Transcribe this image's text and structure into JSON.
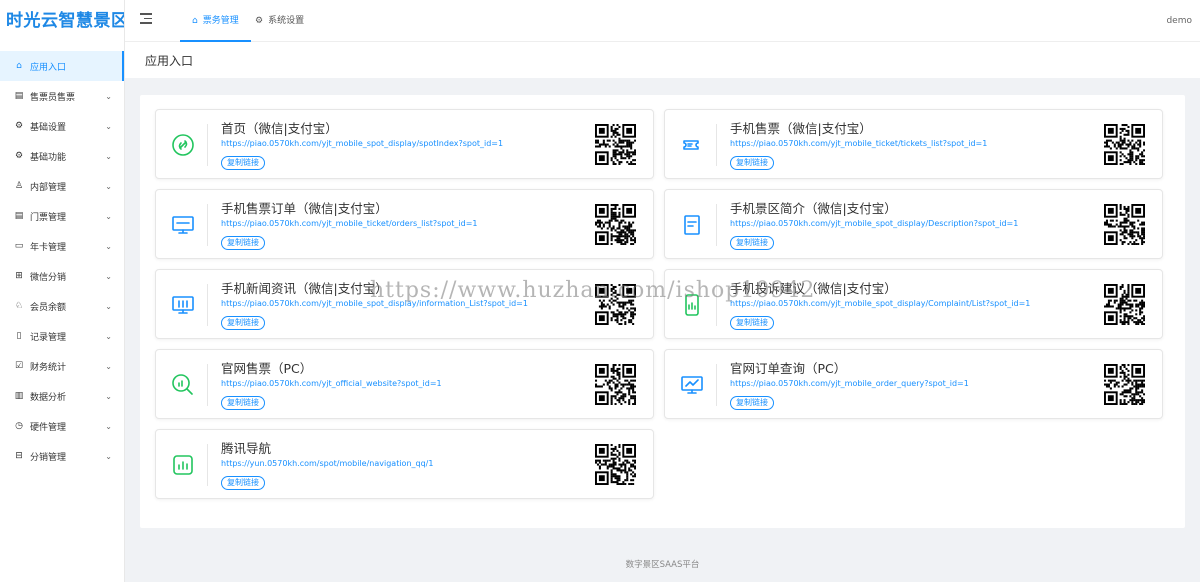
{
  "app": {
    "logo": "时光云智慧景区",
    "user": "demo"
  },
  "header": {
    "tabs": [
      {
        "label": "票务管理",
        "icon": "home-icon"
      },
      {
        "label": "系统设置",
        "icon": "gear-icon"
      }
    ]
  },
  "sidebar": {
    "items": [
      {
        "label": "应用入口",
        "icon": "home-icon",
        "active": true
      },
      {
        "label": "售票员售票",
        "icon": "ticket-icon"
      },
      {
        "label": "基础设置",
        "icon": "gear-icon"
      },
      {
        "label": "基础功能",
        "icon": "gear-icon"
      },
      {
        "label": "内部管理",
        "icon": "user-icon"
      },
      {
        "label": "门票管理",
        "icon": "ticket-icon"
      },
      {
        "label": "年卡管理",
        "icon": "card-icon"
      },
      {
        "label": "微信分销",
        "icon": "network-icon"
      },
      {
        "label": "会员余额",
        "icon": "users-icon"
      },
      {
        "label": "记录管理",
        "icon": "document-icon"
      },
      {
        "label": "财务统计",
        "icon": "check-square-icon"
      },
      {
        "label": "数据分析",
        "icon": "bar-chart-icon"
      },
      {
        "label": "硬件管理",
        "icon": "clock-icon"
      },
      {
        "label": "分销管理",
        "icon": "sitemap-icon"
      }
    ]
  },
  "page": {
    "title": "应用入口"
  },
  "cards": [
    {
      "title": "首页（微信|支付宝）",
      "url": "https://piao.0570kh.com/yjt_mobile_spot_display/spotIndex?spot_id=1",
      "icon": "link-icon",
      "color": "#22c55e"
    },
    {
      "title": "手机售票（微信|支付宝）",
      "url": "https://piao.0570kh.com/yjt_mobile_ticket/tickets_list?spot_id=1",
      "icon": "ticket-icon",
      "color": "#1890ff"
    },
    {
      "title": "手机售票订单（微信|支付宝）",
      "url": "https://piao.0570kh.com/yjt_mobile_ticket/orders_list?spot_id=1",
      "icon": "monitor-icon",
      "color": "#1890ff"
    },
    {
      "title": "手机景区简介（微信|支付宝）",
      "url": "https://piao.0570kh.com/yjt_mobile_spot_display/Description?spot_id=1",
      "icon": "document-icon",
      "color": "#1890ff"
    },
    {
      "title": "手机新闻资讯（微信|支付宝）",
      "url": "https://piao.0570kh.com/yjt_mobile_spot_display/information_List?spot_id=1",
      "icon": "monitor-chart-icon",
      "color": "#1890ff"
    },
    {
      "title": "手机投诉建议（微信|支付宝）",
      "url": "https://piao.0570kh.com/yjt_mobile_spot_display/Complaint/List?spot_id=1",
      "icon": "phone-chart-icon",
      "color": "#22c55e"
    },
    {
      "title": "官网售票（PC）",
      "url": "https://piao.0570kh.com/yjt_official_website?spot_id=1",
      "icon": "search-chart-icon",
      "color": "#22c55e"
    },
    {
      "title": "官网订单查询（PC）",
      "url": "https://piao.0570kh.com/yjt_mobile_order_query?spot_id=1",
      "icon": "monitor-line-icon",
      "color": "#1890ff"
    },
    {
      "title": "腾讯导航",
      "url": "https://yun.0570kh.com/spot/mobile/navigation_qq/1",
      "icon": "bar-chart-icon",
      "color": "#22c55e"
    }
  ],
  "copy_label": "复制链接",
  "watermark": "https://www.huzhan.com/ishop10942",
  "footer": "数字景区SAAS平台"
}
